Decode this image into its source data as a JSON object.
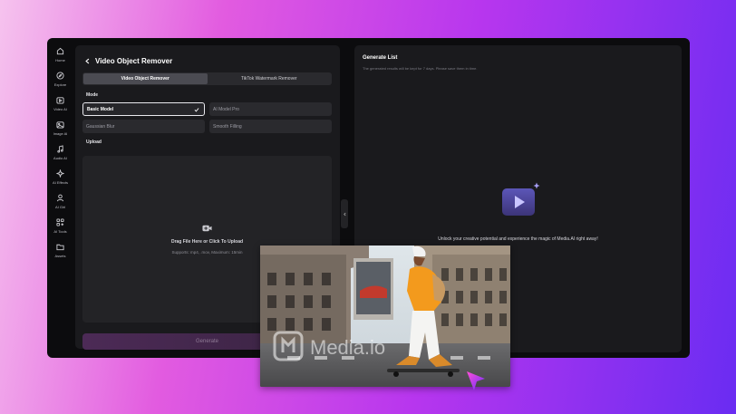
{
  "sidebar": {
    "items": [
      {
        "label": "Home",
        "icon": "home-icon"
      },
      {
        "label": "Explore",
        "icon": "compass-icon"
      },
      {
        "label": "Video AI",
        "icon": "video-icon"
      },
      {
        "label": "Image AI",
        "icon": "image-icon"
      },
      {
        "label": "Audio AI",
        "icon": "music-icon"
      },
      {
        "label": "AI Effects",
        "icon": "sparkle-icon"
      },
      {
        "label": "AI Girl",
        "icon": "person-icon"
      },
      {
        "label": "AI Tools",
        "icon": "tools-icon"
      },
      {
        "label": "Assets",
        "icon": "folder-icon"
      }
    ]
  },
  "left_panel": {
    "title": "Video Object Remover",
    "tabs": [
      {
        "label": "Video Object Remover",
        "active": true
      },
      {
        "label": "TikTok Watermark Remover",
        "active": false
      }
    ],
    "mode_label": "Mode",
    "modes": [
      {
        "label": "Basic Model",
        "selected": true
      },
      {
        "label": "AI Model Pro",
        "selected": false
      },
      {
        "label": "Gaussian Blur",
        "selected": false
      },
      {
        "label": "Smooth Filling",
        "selected": false
      }
    ],
    "upload_label": "Upload",
    "upload_main": "Drag File Here or Click To Upload",
    "upload_sub": "Supports: mp4, .mov, Maximum: 15min",
    "generate_label": "Generate"
  },
  "right_panel": {
    "title": "Generate List",
    "subtitle": "The generated results will be kept for 7 days. Please save them in time.",
    "empty_text": "Unlock your creative potential and experience the magic of Media.AI right away!"
  },
  "overlay": {
    "watermark": "Media.io"
  },
  "colors": {
    "accent": "#7b5cff",
    "cursor": "#9b3bff"
  }
}
